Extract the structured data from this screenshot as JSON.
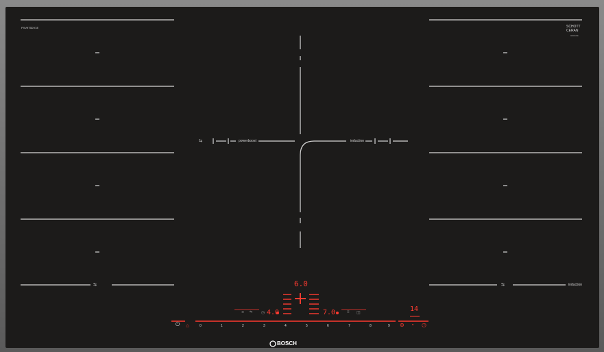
{
  "model_code": "PXV975DV1E",
  "glass_brand": {
    "line1": "SCHOTT",
    "line2": "CERAN",
    "sub": "ceran.de"
  },
  "brand": "BOSCH",
  "labels": {
    "powerboost": "powerboost",
    "induction_center": "induction",
    "induction_right": "induction"
  },
  "zone_mark": "–",
  "displays": {
    "main_power": "6.0",
    "left_power": "4.0",
    "center_power": "7.0",
    "timer": "14"
  },
  "power_scale": [
    "0",
    "1",
    "2",
    "3",
    "4",
    "5",
    "6",
    "7",
    "8",
    "9"
  ],
  "colors": {
    "glass": "#1c1b1a",
    "lines": "#d8d8d8",
    "display": "#ff3b30"
  },
  "icons": {
    "power": "power-icon",
    "child_lock": "child-lock-icon",
    "flex_zone": "flex-zone-icon",
    "timer": "timer-icon",
    "keep_warm": "keep-warm-icon",
    "pan_detect": "pan-detect-icon"
  }
}
